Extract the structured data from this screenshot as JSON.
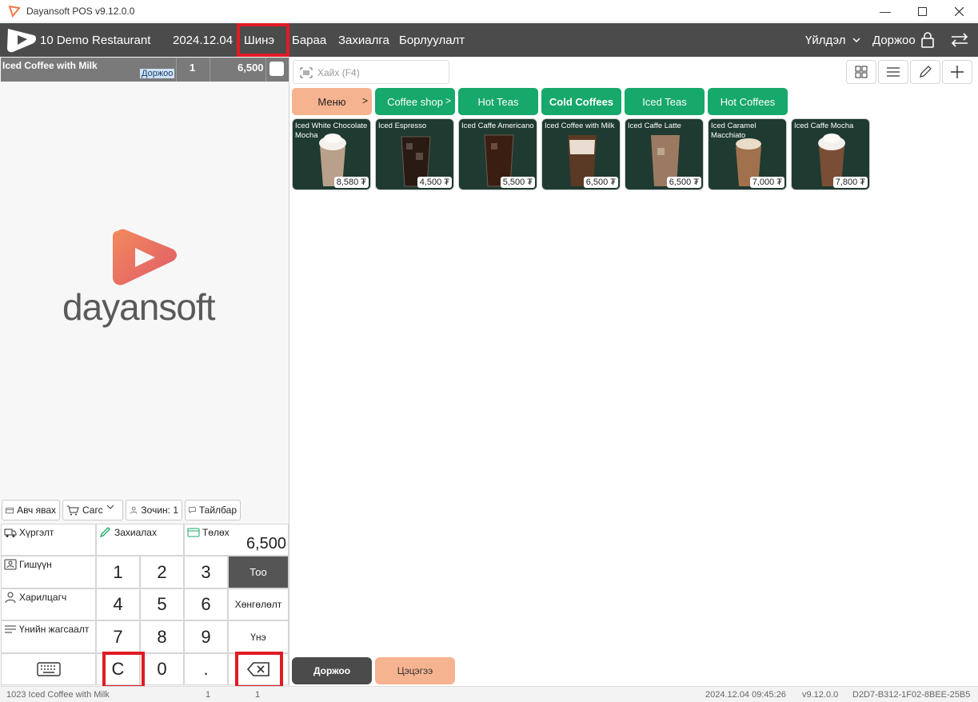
{
  "window": {
    "title": "Dayansoft POS v9.12.0.0",
    "controls": [
      "minimize-icon",
      "maximize-icon",
      "close-icon"
    ]
  },
  "topnav": {
    "restaurant": "10 Demo Restaurant",
    "date": "2024.12.04",
    "new_label": "Шинэ",
    "products_label": "Бараа",
    "orders_label": "Захиалга",
    "sales_label": "Борлуулалт",
    "operations_label": "Үйлдэл",
    "user_label": "Доржоо"
  },
  "order": {
    "items": [
      {
        "name": "Iced Coffee with Milk",
        "staff": "Доржоо",
        "qty": "1",
        "amount": "6,500"
      }
    ]
  },
  "brand": {
    "name": "dayansoft"
  },
  "actions": {
    "takeaway": "Авч явах",
    "cart": "Сагс",
    "guests": "Зочин: 1",
    "note": "Тайлбар"
  },
  "side_buttons": {
    "delivery": "Хүргэлт",
    "order": "Захиалах",
    "payment": "Төлөх",
    "member": "Гишүүн",
    "customer": "Харилцагч",
    "price_list": "Үнийн жагсаалт"
  },
  "total": "6,500",
  "keypad": {
    "keys": [
      "1",
      "2",
      "3",
      "4",
      "5",
      "6",
      "7",
      "8",
      "9",
      "C",
      "0",
      "."
    ],
    "qty_label": "Тоо",
    "discount_label": "Хөнгөлөлт",
    "price_label": "Үнэ"
  },
  "search": {
    "placeholder": "Хайх (F4)"
  },
  "categories": [
    {
      "label": "Меню",
      "color": "#f6b38f",
      "has_arrow": true
    },
    {
      "label": "Coffee shop",
      "color": "#17a86b",
      "has_arrow": true
    },
    {
      "label": "Hot Teas",
      "color": "#17a86b"
    },
    {
      "label": "Cold Coffees",
      "color": "#17a86b"
    },
    {
      "label": "Iced Teas",
      "color": "#17a86b"
    },
    {
      "label": "Hot Coffees",
      "color": "#17a86b"
    }
  ],
  "arrow_glyph": ">",
  "products": [
    {
      "name": "Iced White Chocolate Mocha",
      "price": "8,580 ₮"
    },
    {
      "name": "Iced Espresso",
      "price": "4,500 ₮"
    },
    {
      "name": "Iced Caffe Americano",
      "price": "5,500 ₮"
    },
    {
      "name": "Iced Coffee with Milk",
      "price": "6,500 ₮"
    },
    {
      "name": "Iced Caffe Latte",
      "price": "6,500 ₮"
    },
    {
      "name": "Iced Caramel Macchiato",
      "price": "7,000 ₮"
    },
    {
      "name": "Iced Caffe Mocha",
      "price": "7,800 ₮"
    }
  ],
  "footer_buttons": {
    "user": "Доржоо",
    "clear": "Цэцэгээ"
  },
  "statusbar": {
    "item": "1023 Iced Coffee with Milk",
    "qty1": "1",
    "qty2": "1",
    "datetime": "2024.12.04 09:45:26",
    "version": "v9.12.0.0",
    "device_id": "D2D7-B312-1F02-8BEE-25B5"
  }
}
